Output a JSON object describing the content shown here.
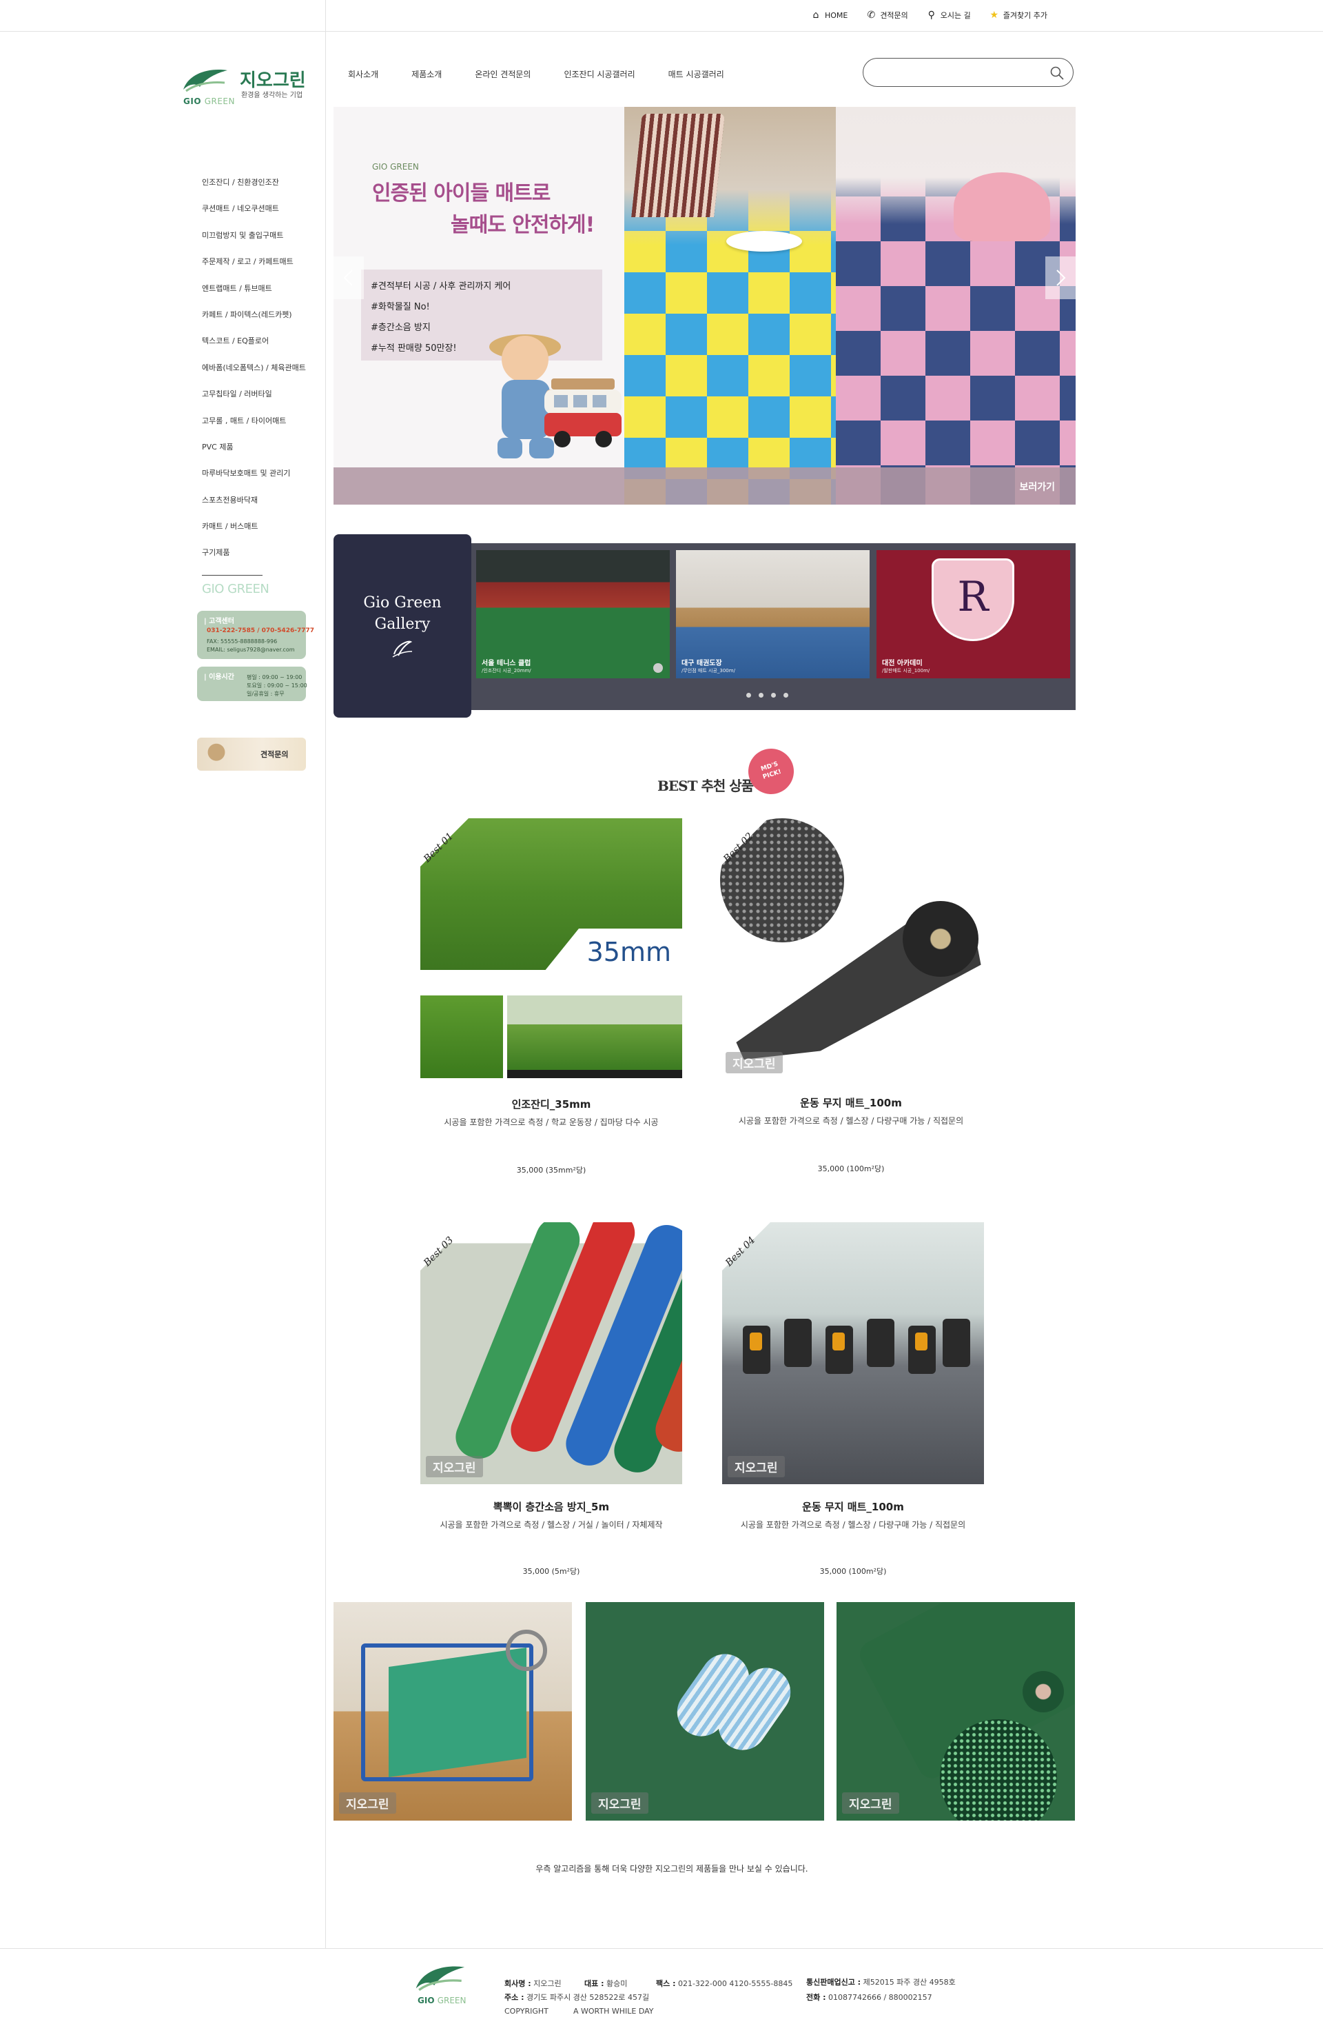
{
  "util": {
    "home": "HOME",
    "estimate": "견적문의",
    "directions": "오시는 길",
    "bookmark": "즐겨찾기 추가"
  },
  "logo": {
    "name": "지오그린",
    "slogan": "환경을 생각하는 기업",
    "gio": "GIO",
    "green": "GREEN"
  },
  "nav": [
    "회사소개",
    "제품소개",
    "온라인 견적문의",
    "인조잔디 시공갤러리",
    "매트 시공갤러리"
  ],
  "search": {
    "placeholder": ""
  },
  "categories": [
    "인조잔디 / 친환경인조잔",
    "쿠션매트 / 네오쿠션매트",
    "미끄럼방지 및 출입구매트",
    "주문제작 / 로고 / 카페트매트",
    "엔트랩매트 / 튜브매트",
    "카페트 / 파이텍스(레드카펫)",
    "텍스코트 / EQ플로어",
    "에바폼(네오폼텍스) / 체육관매트",
    "고무칩타일 / 러버타일",
    "고무롤 , 매트 / 타이어매트",
    "PVC 제품",
    "마루바닥보호매트 및 관리기",
    "스포츠전용바닥재",
    "카매트 / 버스매트",
    "구기제품"
  ],
  "sidebar_brand": "GIO GREEN",
  "cs": {
    "title": "고객센터",
    "phone": "031-222-7585 / 070-5426-7777",
    "fax": "FAX: 55555-8888888-996",
    "email": "EMAIL: seligus7928@naver.com",
    "hours_title": "이용시간",
    "hours_1": "평일 : 09:00 ~ 19:00",
    "hours_2": "토요일 : 09:00 ~ 15:00",
    "hours_3": "일/공휴일 : 휴무"
  },
  "estimate_banner": "견적문의",
  "hero": {
    "brand": "GIO GREEN",
    "headline_1": "인증된 아이들 매트로",
    "headline_2": "놀때도 안전하게!",
    "bullets": [
      "#견적부터 시공 / 사후 관리까지 케어",
      "#화학물질 No!",
      "#층간소음 방지",
      "#누적 판매량 50만장!"
    ],
    "more": "보러가기"
  },
  "gallery": {
    "title_1": "Gio Green",
    "title_2": "Gallery",
    "cards": [
      {
        "caption": "서울 테니스 클럽",
        "sub": "/인조잔디 시공_20mm/"
      },
      {
        "caption": "대구 태권도장",
        "sub": "/무인점 매트 시공_300m/"
      },
      {
        "caption": "대전 아카데미",
        "sub": "/발판매트 시공_100m/"
      }
    ],
    "crest_letter": "R"
  },
  "best": {
    "title": "BEST 추천 상품",
    "badge_1": "MD'S",
    "badge_2": "PICK!",
    "watermark": "지오그린",
    "items": [
      {
        "tag": "Best 01",
        "name": "인조잔디_35mm",
        "desc": "시공을 포함한 가격으로 측정 / 학교 운동장 / 집마당 다수 시공",
        "price": "35,000 (35mm²당)",
        "label": "35mm"
      },
      {
        "tag": "Best 02",
        "name": "운동 무지 매트_100m",
        "desc": "시공을 포함한 가격으로 측정 / 헬스장 / 다량구매 가능 / 직접문의",
        "price": "35,000 (100m²당)"
      },
      {
        "tag": "Best 03",
        "name": "뽁뽁이 층간소음 방지_5m",
        "desc": "시공을 포함한 가격으로 측정 / 헬스장 / 거실 / 놀이터 / 자체제작",
        "price": "35,000 (5m²당)"
      },
      {
        "tag": "Best 04",
        "name": "운동 무지 매트_100m",
        "desc": "시공을 포함한 가격으로 측정 / 헬스장 / 다량구매 가능 / 직접문의",
        "price": "35,000 (100m²당)"
      }
    ]
  },
  "bottom_note": "우측 알고리즘을 통해 더욱 다양한 지오그린의 제품들을 만나 보실 수 있습니다.",
  "footer": {
    "company_label": "회사명 :",
    "company": "지오그린",
    "ceo_label": "대표 :",
    "ceo": "황승미",
    "fax_label": "팩스 :",
    "fax": "021-322-000 4120-5555-8845",
    "reg_label": "통신판매업신고 :",
    "reg": "제52015 파주 경산 4958호",
    "addr_label": "주소 :",
    "addr": "경기도 파주시 경산 528522로 457길",
    "tel_label": "전화 :",
    "tel": "01087742666 / 880002157",
    "copyright": "COPYRIGHT",
    "tagline": "A WORTH WHILE DAY"
  },
  "colors": {
    "brand_green": "#2a7a53",
    "hero_pink": "#a64e8c",
    "cs_box": "#b7cdb8",
    "gallery_navy": "#2b2d44",
    "badge_red": "#e35a6f"
  }
}
